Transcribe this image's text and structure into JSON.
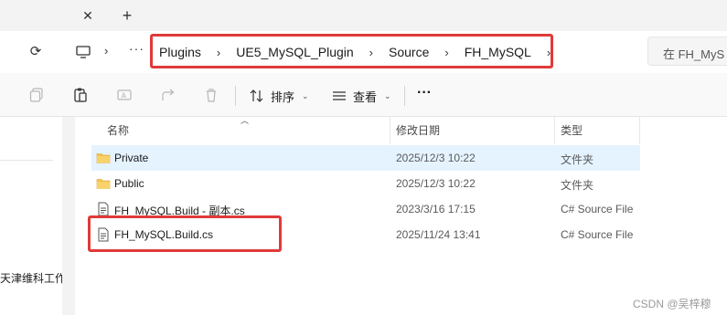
{
  "tabs": {
    "close_glyph": "✕",
    "new_glyph": "+"
  },
  "address": {
    "refresh_glyph": "⟳",
    "more_glyph": "···",
    "chevron": "›",
    "breadcrumbs": [
      "Plugins",
      "UE5_MySQL_Plugin",
      "Source",
      "FH_MySQL"
    ],
    "search_placeholder": "在 FH_MyS"
  },
  "toolbar": {
    "sort_label": "排序",
    "view_label": "查看",
    "more_glyph": "···"
  },
  "sidebar": {
    "item_label": "天津维科工作"
  },
  "columns": {
    "name": "名称",
    "date": "修改日期",
    "type": "类型"
  },
  "files": [
    {
      "name": "Private",
      "date": "2025/12/3 10:22",
      "type": "文件夹",
      "icon": "folder-icon",
      "selected": true
    },
    {
      "name": "Public",
      "date": "2025/12/3 10:22",
      "type": "文件夹",
      "icon": "folder-icon",
      "selected": false
    },
    {
      "name": "FH_MySQL.Build - 副本.cs",
      "date": "2023/3/16 17:15",
      "type": "C# Source File",
      "icon": "cs-file-icon",
      "selected": false
    },
    {
      "name": "FH_MySQL.Build.cs",
      "date": "2025/11/24 13:41",
      "type": "C# Source File",
      "icon": "cs-file-icon",
      "selected": false
    }
  ],
  "watermark": "CSDN @吴梓穆",
  "colors": {
    "highlight": "#e03a3a",
    "selected_row": "#e5f3ff",
    "folder": "#f4c24d"
  }
}
